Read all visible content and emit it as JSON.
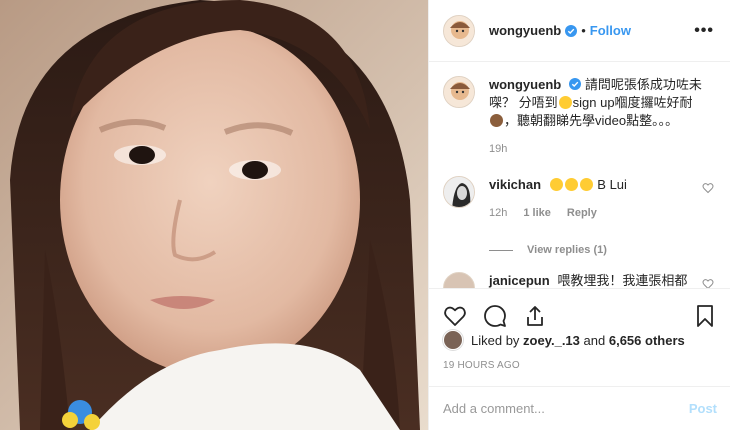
{
  "post": {
    "author": "wongyuenb",
    "follow_label": "Follow",
    "dot": "•",
    "more_label": "•••",
    "caption": {
      "username": "wongyuenb",
      "text_part1": "請問呢張係成功咗未㗎？ 分唔到",
      "text_part2": "sign up嗰度攞咗好耐",
      "text_part3": "，聽朝翻睇先學video點整。。。",
      "time": "19h"
    },
    "comments": [
      {
        "username": "vikichan",
        "text": "B Lui",
        "emoji_count": 3,
        "time": "12h",
        "likes": "1 like",
        "reply_label": "Reply",
        "view_replies": "View replies (1)"
      },
      {
        "username": "janicepun",
        "text": "喂教埋我！我連張相都"
      }
    ],
    "likes": {
      "prefix": "Liked by",
      "user": "zoey._.13",
      "middle": "and",
      "others": "6,656 others"
    },
    "time_ago": "19 HOURS AGO",
    "add_comment_placeholder": "Add a comment...",
    "post_label": "Post"
  },
  "colors": {
    "accent": "#3897f0",
    "post_disabled": "#b2dffc",
    "muted": "#8e8e8e",
    "text": "#262626"
  },
  "icons": [
    "heart-icon",
    "comment-icon",
    "share-icon",
    "bookmark-icon",
    "verified-badge-icon",
    "heart-small-icon"
  ]
}
